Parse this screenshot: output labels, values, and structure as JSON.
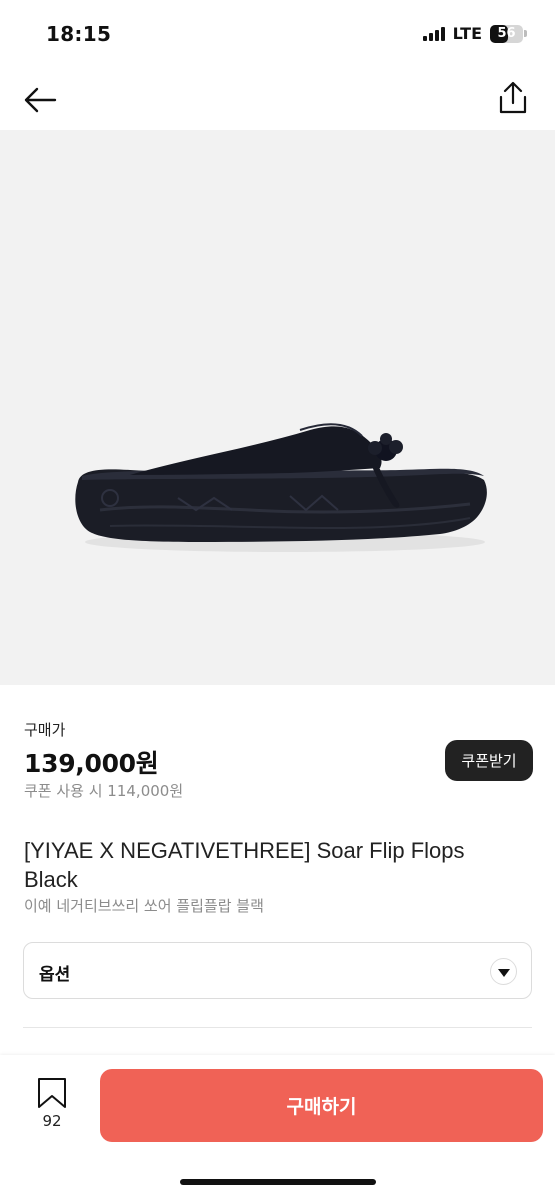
{
  "status_bar": {
    "time": "18:15",
    "network": "LTE",
    "battery_level": "56"
  },
  "header": {
    "back_icon": "arrow-left-icon",
    "share_icon": "share-icon"
  },
  "product": {
    "image_icon": "sandal-image",
    "price_label": "구매가",
    "price": "139,000원",
    "coupon_price": "쿠폰 사용 시 114,000원",
    "coupon_button": "쿠폰받기",
    "title": "[YIYAE X NEGATIVETHREE] Soar Flip Flops Black",
    "subtitle": "이예 네거티브쓰리 쏘어 플립플랍 블랙"
  },
  "options": {
    "label": "옵션",
    "icon": "chevron-down-icon"
  },
  "bottom_bar": {
    "bookmark_icon": "bookmark-icon",
    "bookmark_count": "92",
    "buy_button": "구매하기",
    "accent_color": "#f06256"
  }
}
